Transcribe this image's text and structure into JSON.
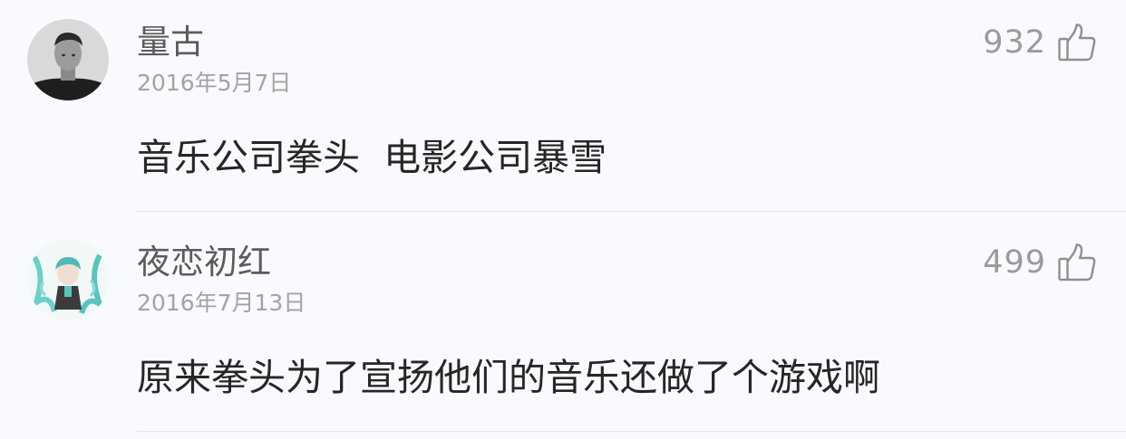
{
  "comments": [
    {
      "username": "量古",
      "date": "2016年5月7日",
      "likes": "932",
      "content": "音乐公司拳头  电影公司暴雪",
      "avatar": "male-portrait-avatar"
    },
    {
      "username": "夜恋初红",
      "date": "2016年7月13日",
      "likes": "499",
      "content": "原来拳头为了宣扬他们的音乐还做了个游戏啊",
      "avatar": "anime-character-avatar"
    }
  ],
  "icons": {
    "like": "thumbs-up-icon"
  },
  "colors": {
    "background": "#f9fafd",
    "username": "#5c5c5c",
    "date": "#a3a3a3",
    "content": "#262626",
    "like_count": "#9b9b9b",
    "divider": "#e3e3e3"
  }
}
